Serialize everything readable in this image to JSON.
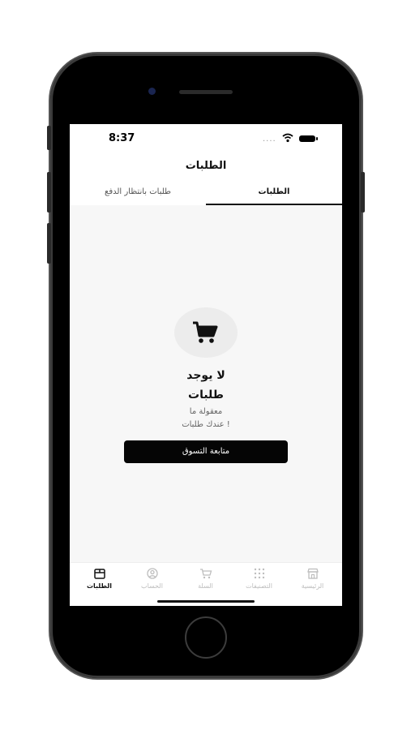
{
  "status_bar": {
    "time": "8:37",
    "signal": "...."
  },
  "header": {
    "title": "الطلبات"
  },
  "tabs": [
    {
      "label": "الطلبات",
      "active": true
    },
    {
      "label": "طلبات بانتظار الدفع",
      "active": false
    }
  ],
  "empty_state": {
    "line1": "لا يوجد",
    "line2": "طلبات",
    "sub1": "معقولة ما",
    "sub2": "عندك طلبات !",
    "button_label": "متابعة التسوق",
    "icon": "shopping-cart-icon"
  },
  "bottom_nav": {
    "items": [
      {
        "label": "الطلبات",
        "icon": "orders-box-icon",
        "active": true
      },
      {
        "label": "الحساب",
        "icon": "account-icon",
        "active": false
      },
      {
        "label": "السلة",
        "icon": "cart-icon",
        "active": false
      },
      {
        "label": "التصنيفات",
        "icon": "categories-grid-icon",
        "active": false
      },
      {
        "label": "الرئيسية",
        "icon": "store-icon",
        "active": false
      }
    ]
  },
  "colors": {
    "accent": "#000000",
    "screen_bg": "#f7f7f7",
    "inactive": "#bdbdbd"
  }
}
